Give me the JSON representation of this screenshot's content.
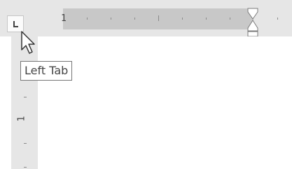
{
  "tab_selector": {
    "icon": "left-tab-icon",
    "tooltip": "Left Tab"
  },
  "horizontal_ruler": {
    "number_label": "1"
  },
  "vertical_ruler": {
    "number_label": "1"
  },
  "colors": {
    "ruler_background": "#e6e6e6",
    "text_area": "#c8c8c8",
    "page": "#ffffff"
  }
}
